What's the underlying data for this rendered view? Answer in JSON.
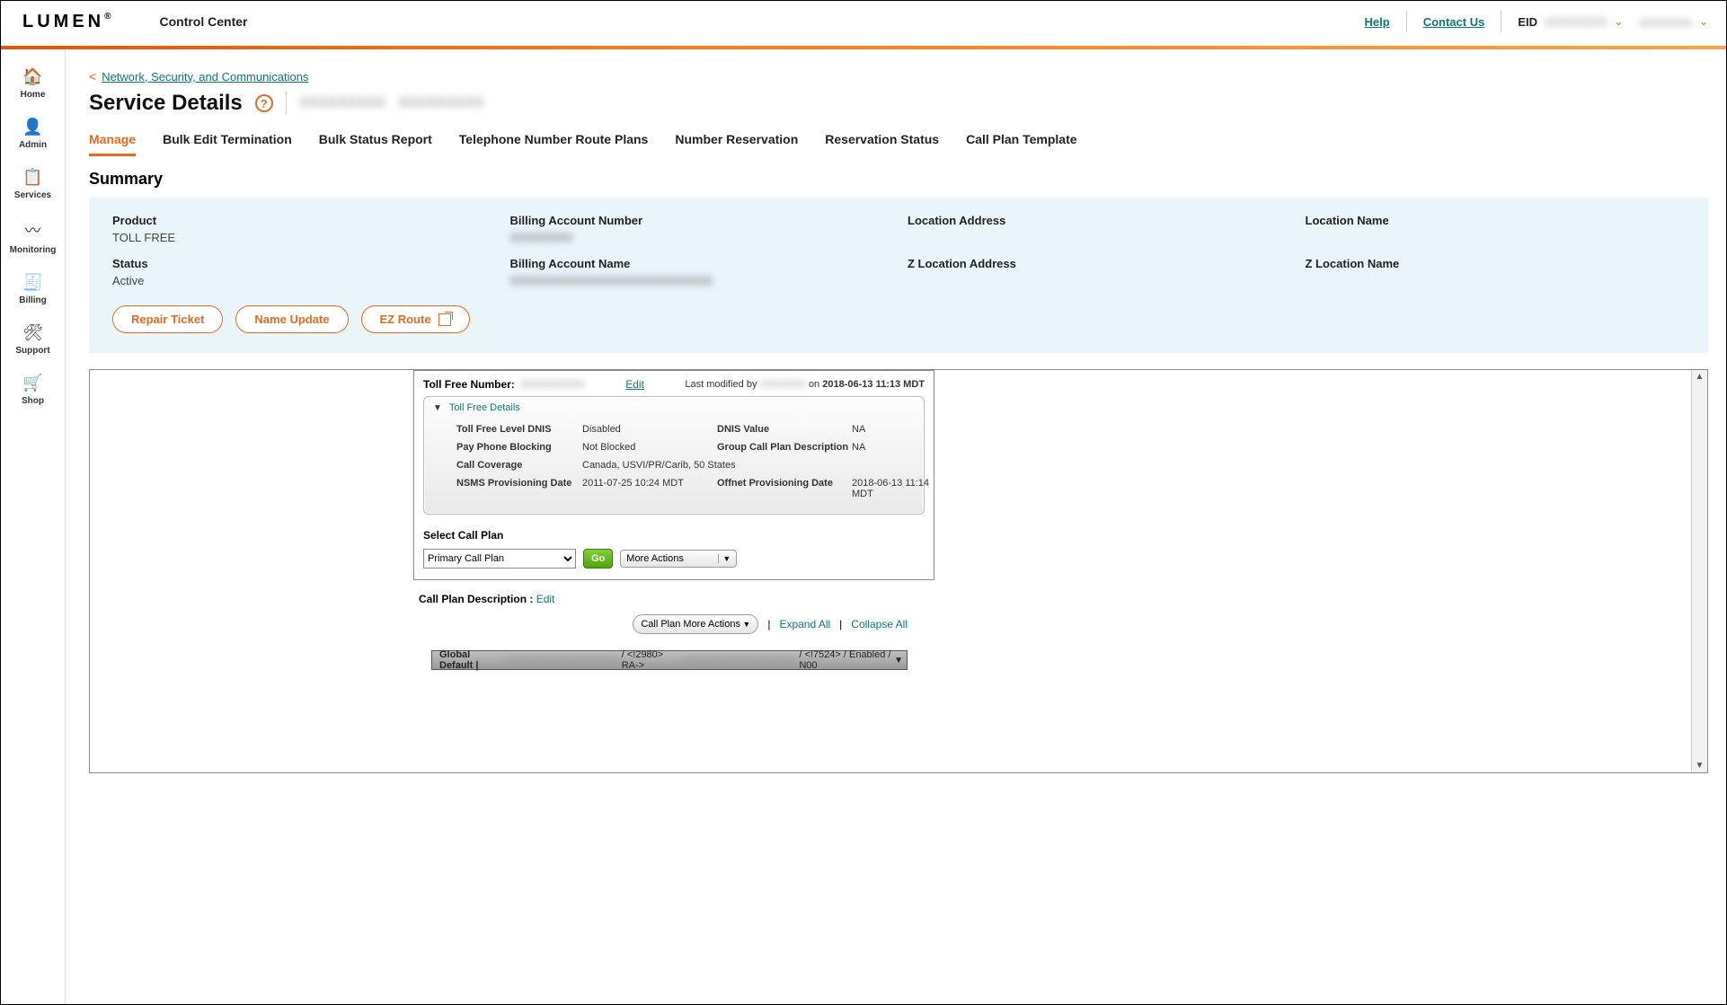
{
  "brand": {
    "name": "LUMEN",
    "product": "Control Center"
  },
  "topnav": {
    "help": "Help",
    "contact": "Contact Us",
    "eid_label": "EID",
    "eid_value": "XXXXXXXX",
    "user_value": "xxxxxxxxx"
  },
  "sidebar": {
    "items": [
      {
        "icon": "🏠",
        "label": "Home"
      },
      {
        "icon": "👤",
        "label": "Admin"
      },
      {
        "icon": "📋",
        "label": "Services"
      },
      {
        "icon": "〰",
        "label": "Monitoring"
      },
      {
        "icon": "🧾",
        "label": "Billing"
      },
      {
        "icon": "🛠",
        "label": "Support"
      },
      {
        "icon": "🛒",
        "label": "Shop"
      }
    ]
  },
  "breadcrumb": {
    "back_icon": "<",
    "link": "Network, Security, and Communications"
  },
  "page": {
    "title": "Service Details",
    "subtitle_1": "XXXXXXXXX",
    "subtitle_2": "XXXXXXXXX"
  },
  "tabs": [
    "Manage",
    "Bulk Edit Termination",
    "Bulk Status Report",
    "Telephone Number Route Plans",
    "Number Reservation",
    "Reservation Status",
    "Call Plan Template"
  ],
  "summary": {
    "heading": "Summary",
    "fields": {
      "product": {
        "label": "Product",
        "value": "TOLL FREE"
      },
      "ban": {
        "label": "Billing Account Number",
        "value": "XXXXXXXX"
      },
      "loc": {
        "label": "Location Address",
        "value": ""
      },
      "locname": {
        "label": "Location Name",
        "value": ""
      },
      "status": {
        "label": "Status",
        "value": "Active"
      },
      "banname": {
        "label": "Billing Account Name",
        "value": "XXXXXXXXXXXXXXXXXXXXXXXXXX"
      },
      "zloc": {
        "label": "Z Location Address",
        "value": ""
      },
      "zlocname": {
        "label": "Z Location Name",
        "value": ""
      }
    },
    "buttons": {
      "repair": "Repair Ticket",
      "rename": "Name Update",
      "ezroute": "EZ Route"
    }
  },
  "tfn": {
    "label": "Toll Free Number:",
    "value": "XXXXXXXXX",
    "edit": "Edit",
    "lastmod_prefix": "Last modified by",
    "lastmod_user": "XXXXXXX",
    "lastmod_mid": "on",
    "lastmod_ts": "2018-06-13 11:13 MDT",
    "details_title": "Toll Free Details",
    "details": {
      "dnis_label": "Toll Free Level DNIS",
      "dnis_value": "Disabled",
      "dnisv_label": "DNIS Value",
      "dnisv_value": "NA",
      "ppb_label": "Pay Phone Blocking",
      "ppb_value": "Not Blocked",
      "gcp_label": "Group Call Plan Description",
      "gcp_value": "NA",
      "cc_label": "Call Coverage",
      "cc_value": "Canada, USVI/PR/Carib, 50 States",
      "nsms_label": "NSMS Provisioning Date",
      "nsms_value": "2011-07-25 10:24 MDT",
      "off_label": "Offnet Provisioning Date",
      "off_value": "2018-06-13 11:14 MDT"
    },
    "select_label": "Select Call Plan",
    "select_value": "Primary Call Plan",
    "go": "Go",
    "more_actions": "More Actions"
  },
  "callplan": {
    "desc_label": "Call Plan Description :",
    "desc_edit": "Edit",
    "more": "Call Plan More Actions",
    "expand": "Expand All",
    "collapse": "Collapse All",
    "global_prefix": "Global Default |",
    "global_mid1": "/ <!2980> RA->",
    "global_mid2": "/ <!7524> / Enabled / N00",
    "global_blur1": "XXXXXXXXXXXXXXXXX",
    "global_blur2": "XXXXXXXXXXXXXXXXX"
  }
}
